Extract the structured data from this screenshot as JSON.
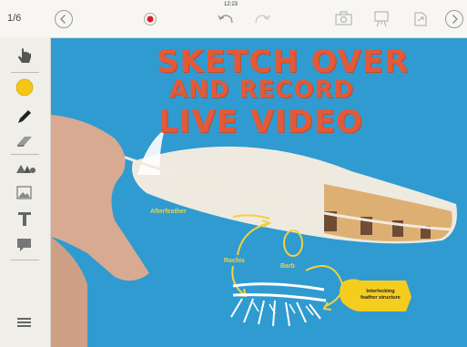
{
  "toolbar": {
    "page_indicator": "1/6",
    "time": "12:23",
    "back_icon": "chevron-left-icon",
    "forward_icon": "chevron-right-icon",
    "record_icon": "record-icon",
    "undo_icon": "undo-icon",
    "redo_icon": "redo-icon",
    "camera_icon": "camera-icon",
    "presentation_icon": "presentation-icon",
    "share_icon": "share-icon"
  },
  "sidebar": {
    "tools": [
      "hand-icon",
      "color-swatch-icon",
      "pen-icon",
      "eraser-icon",
      "shapes-icon",
      "image-icon",
      "text-icon",
      "comment-icon",
      "menu-icon"
    ],
    "active_color": "#f5c518"
  },
  "canvas": {
    "headline_line1": "SKETCH OVER",
    "headline_line2": "AND RECORD",
    "headline_line3": "LIVE VIDEO",
    "label_afterfeather": "Afterfeather",
    "label_rachis": "Rachis",
    "label_barb": "Barb",
    "callout_line1": "Interlocking",
    "callout_line2": "feather structure",
    "colors": {
      "background": "#2f9bd0",
      "annotation": "#f4d03f",
      "headline": "#e25a3a"
    }
  }
}
